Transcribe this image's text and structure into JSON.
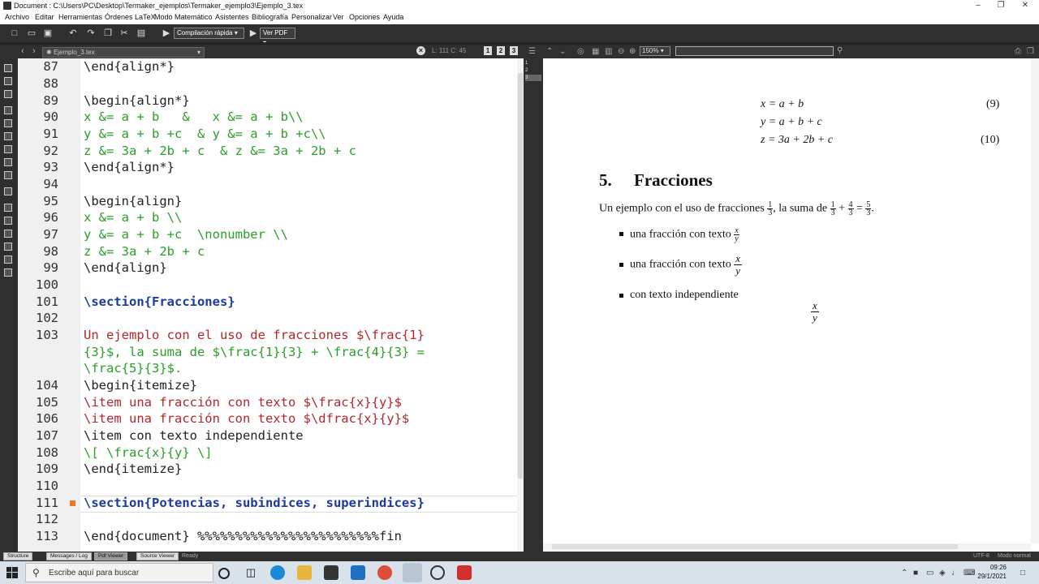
{
  "window": {
    "title": "Document : C:\\Users\\PC\\Desktop\\Termaker_ejemplos\\Termaker_ejemplo3\\Ejemplo_3.tex"
  },
  "menu": [
    "Archivo",
    "Editar",
    "Herramientas",
    "Órdenes LaTeX",
    "Modo Matemático",
    "Asistentes",
    "Bibliografía",
    "Personalizar",
    "Ver",
    "Opciones",
    "Ayuda"
  ],
  "toolbar": {
    "compile_label": "Compilación rápida",
    "view_label": "Ver PDF"
  },
  "editor": {
    "tab_file": "Ejemplo_3.tex",
    "cursor_pos": "L: 111 C: 45",
    "view_buttons": [
      "1",
      "2",
      "3"
    ],
    "lines": [
      {
        "n": "87",
        "t": "\\end{align*}"
      },
      {
        "n": "88",
        "t": ""
      },
      {
        "n": "89",
        "t": "\\begin{align*}"
      },
      {
        "n": "90",
        "t": "x &= a + b   &   x &= a + b\\\\"
      },
      {
        "n": "91",
        "t": "y &= a + b +c  & y &= a + b +c\\\\"
      },
      {
        "n": "92",
        "t": "z &= 3a + 2b + c  & z &= 3a + 2b + c"
      },
      {
        "n": "93",
        "t": "\\end{align*}"
      },
      {
        "n": "94",
        "t": ""
      },
      {
        "n": "95",
        "t": "\\begin{align}"
      },
      {
        "n": "96",
        "t": "x &= a + b \\\\"
      },
      {
        "n": "97",
        "t": "y &= a + b +c  \\nonumber \\\\"
      },
      {
        "n": "98",
        "t": "z &= 3a + 2b + c"
      },
      {
        "n": "99",
        "t": "\\end{align}"
      },
      {
        "n": "100",
        "t": ""
      },
      {
        "n": "101",
        "t": "\\section{Fracciones}"
      },
      {
        "n": "102",
        "t": ""
      },
      {
        "n": "103",
        "t": "Un ejemplo con el uso de fracciones $\\frac{1}"
      },
      {
        "n": "",
        "t": "{3}$, la suma de $\\frac{1}{3} + \\frac{4}{3} ="
      },
      {
        "n": "",
        "t": "\\frac{5}{3}$."
      },
      {
        "n": "104",
        "t": "\\begin{itemize}"
      },
      {
        "n": "105",
        "t": "\\item una fracción con texto $\\frac{x}{y}$"
      },
      {
        "n": "106",
        "t": "\\item una fracción con texto $\\dfrac{x}{y}$"
      },
      {
        "n": "107",
        "t": "\\item con texto independiente"
      },
      {
        "n": "108",
        "t": "\\[ \\frac{x}{y} \\]"
      },
      {
        "n": "109",
        "t": "\\end{itemize}"
      },
      {
        "n": "110",
        "t": ""
      },
      {
        "n": "111",
        "t": "\\section{Potencias, subindices, superindices}"
      },
      {
        "n": "112",
        "t": ""
      },
      {
        "n": "113",
        "t": "\\end{document} %%%%%%%%%%%%%%%%%%%%%%%%fin"
      }
    ]
  },
  "pdf": {
    "zoom": "150%",
    "minimap": [
      "1",
      "2",
      "3"
    ],
    "eq1": "x = a + b",
    "eq1num": "(9)",
    "eq2": "y = a + b + c",
    "eq3": "z = 3a + 2b + c",
    "eq3num": "(10)",
    "section_num": "5.",
    "section_title": "Fracciones",
    "para": "Un ejemplo con el uso de fracciones",
    "para2": ", la suma de",
    "item1": "una fracción con texto",
    "item2": "una fracción con texto",
    "item3": "con texto independiente"
  },
  "status": {
    "buttons": [
      "Structure",
      "Messages / Log",
      "Pdf Viewer",
      "Source Viewer"
    ],
    "ready": "Ready",
    "encoding": "UTF-8",
    "mode": "Modo normal"
  },
  "taskbar": {
    "search_placeholder": "Escribe aquí para buscar",
    "time": "09:26",
    "date": "29/1/2021"
  }
}
